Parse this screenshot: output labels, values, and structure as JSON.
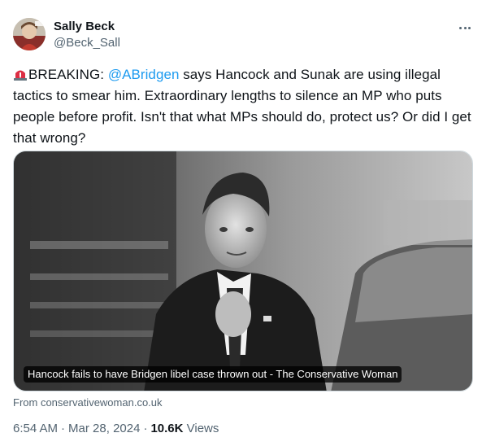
{
  "author": {
    "name": "Sally Beck",
    "handle": "@Beck_Sall",
    "avatar_icon": "avatar-photo"
  },
  "more_icon": "more-horizontal-icon",
  "tweet": {
    "emoji_icon": "rotating-light-siren-icon",
    "text_prefix": "BREAKING: ",
    "mention": "@ABridgen",
    "text_rest": " says Hancock and Sunak are using illegal tactics to smear him. Extraordinary lengths to silence an MP who puts people before profit. Isn't that what MPs should do, protect us? Or did I get that wrong?"
  },
  "card": {
    "caption": "Hancock fails to have Bridgen libel case thrown out - The Conservative Woman",
    "source": "From conservativewoman.co.uk"
  },
  "meta": {
    "time": "6:54 AM",
    "date": "Mar 28, 2024",
    "separator": "·",
    "views_count": "10.6K",
    "views_label": "Views"
  },
  "colors": {
    "link": "#1d9bf0",
    "secondary_text": "#536471",
    "primary_text": "#0f1419",
    "border": "#cfd9de"
  }
}
